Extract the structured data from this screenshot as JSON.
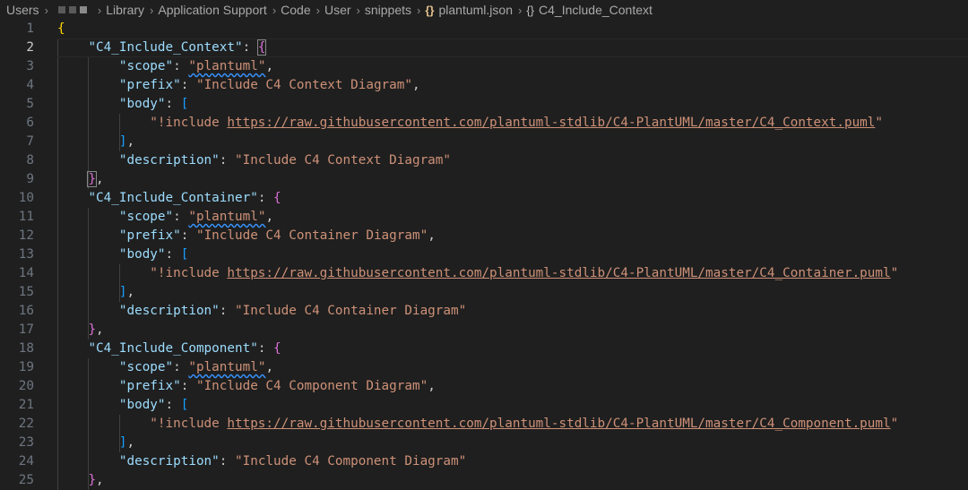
{
  "breadcrumb": {
    "items": [
      "Users",
      "Library",
      "Application Support",
      "Code",
      "User",
      "snippets",
      "plantuml.json",
      "C4_Include_Context"
    ],
    "file_icon": "{}",
    "symbol_icon": "{}"
  },
  "editor": {
    "active_line": 2,
    "lines": [
      {
        "n": "1",
        "tokens": [
          {
            "t": "{",
            "c": "b1"
          }
        ]
      },
      {
        "n": "2",
        "tokens": [
          {
            "t": "    "
          },
          {
            "t": "\"C4_Include_Context\"",
            "c": "k"
          },
          {
            "t": ": ",
            "c": "p"
          },
          {
            "t": "{",
            "c": "b2 bm"
          }
        ]
      },
      {
        "n": "3",
        "tokens": [
          {
            "t": "        "
          },
          {
            "t": "\"scope\"",
            "c": "k"
          },
          {
            "t": ": ",
            "c": "p"
          },
          {
            "t": "\"plantuml\"",
            "c": "s sq-und"
          },
          {
            "t": ",",
            "c": "p"
          }
        ]
      },
      {
        "n": "4",
        "tokens": [
          {
            "t": "        "
          },
          {
            "t": "\"prefix\"",
            "c": "k"
          },
          {
            "t": ": ",
            "c": "p"
          },
          {
            "t": "\"Include C4 Context Diagram\"",
            "c": "s"
          },
          {
            "t": ",",
            "c": "p"
          }
        ]
      },
      {
        "n": "5",
        "tokens": [
          {
            "t": "        "
          },
          {
            "t": "\"body\"",
            "c": "k"
          },
          {
            "t": ": ",
            "c": "p"
          },
          {
            "t": "[",
            "c": "b3"
          }
        ]
      },
      {
        "n": "6",
        "tokens": [
          {
            "t": "            "
          },
          {
            "t": "\"!include ",
            "c": "s"
          },
          {
            "t": "https://raw.githubusercontent.com/plantuml-stdlib/C4-PlantUML/master/C4_Context.puml",
            "c": "s u"
          },
          {
            "t": "\"",
            "c": "s"
          }
        ]
      },
      {
        "n": "7",
        "tokens": [
          {
            "t": "        "
          },
          {
            "t": "]",
            "c": "b3"
          },
          {
            "t": ",",
            "c": "p"
          }
        ]
      },
      {
        "n": "8",
        "tokens": [
          {
            "t": "        "
          },
          {
            "t": "\"description\"",
            "c": "k"
          },
          {
            "t": ": ",
            "c": "p"
          },
          {
            "t": "\"Include C4 Context Diagram\"",
            "c": "s"
          }
        ]
      },
      {
        "n": "9",
        "tokens": [
          {
            "t": "    "
          },
          {
            "t": "}",
            "c": "b2 bm"
          },
          {
            "t": ",",
            "c": "p"
          }
        ]
      },
      {
        "n": "10",
        "tokens": [
          {
            "t": "    "
          },
          {
            "t": "\"C4_Include_Container\"",
            "c": "k"
          },
          {
            "t": ": ",
            "c": "p"
          },
          {
            "t": "{",
            "c": "b2"
          }
        ]
      },
      {
        "n": "11",
        "tokens": [
          {
            "t": "        "
          },
          {
            "t": "\"scope\"",
            "c": "k"
          },
          {
            "t": ": ",
            "c": "p"
          },
          {
            "t": "\"plantuml\"",
            "c": "s sq-und"
          },
          {
            "t": ",",
            "c": "p"
          }
        ]
      },
      {
        "n": "12",
        "tokens": [
          {
            "t": "        "
          },
          {
            "t": "\"prefix\"",
            "c": "k"
          },
          {
            "t": ": ",
            "c": "p"
          },
          {
            "t": "\"Include C4 Container Diagram\"",
            "c": "s"
          },
          {
            "t": ",",
            "c": "p"
          }
        ]
      },
      {
        "n": "13",
        "tokens": [
          {
            "t": "        "
          },
          {
            "t": "\"body\"",
            "c": "k"
          },
          {
            "t": ": ",
            "c": "p"
          },
          {
            "t": "[",
            "c": "b3"
          }
        ]
      },
      {
        "n": "14",
        "tokens": [
          {
            "t": "            "
          },
          {
            "t": "\"!include ",
            "c": "s"
          },
          {
            "t": "https://raw.githubusercontent.com/plantuml-stdlib/C4-PlantUML/master/C4_Container.puml",
            "c": "s u"
          },
          {
            "t": "\"",
            "c": "s"
          }
        ]
      },
      {
        "n": "15",
        "tokens": [
          {
            "t": "        "
          },
          {
            "t": "]",
            "c": "b3"
          },
          {
            "t": ",",
            "c": "p"
          }
        ]
      },
      {
        "n": "16",
        "tokens": [
          {
            "t": "        "
          },
          {
            "t": "\"description\"",
            "c": "k"
          },
          {
            "t": ": ",
            "c": "p"
          },
          {
            "t": "\"Include C4 Container Diagram\"",
            "c": "s"
          }
        ]
      },
      {
        "n": "17",
        "tokens": [
          {
            "t": "    "
          },
          {
            "t": "}",
            "c": "b2"
          },
          {
            "t": ",",
            "c": "p"
          }
        ]
      },
      {
        "n": "18",
        "tokens": [
          {
            "t": "    "
          },
          {
            "t": "\"C4_Include_Component\"",
            "c": "k"
          },
          {
            "t": ": ",
            "c": "p"
          },
          {
            "t": "{",
            "c": "b2"
          }
        ]
      },
      {
        "n": "19",
        "tokens": [
          {
            "t": "        "
          },
          {
            "t": "\"scope\"",
            "c": "k"
          },
          {
            "t": ": ",
            "c": "p"
          },
          {
            "t": "\"plantuml\"",
            "c": "s sq-und"
          },
          {
            "t": ",",
            "c": "p"
          }
        ]
      },
      {
        "n": "20",
        "tokens": [
          {
            "t": "        "
          },
          {
            "t": "\"prefix\"",
            "c": "k"
          },
          {
            "t": ": ",
            "c": "p"
          },
          {
            "t": "\"Include C4 Component Diagram\"",
            "c": "s"
          },
          {
            "t": ",",
            "c": "p"
          }
        ]
      },
      {
        "n": "21",
        "tokens": [
          {
            "t": "        "
          },
          {
            "t": "\"body\"",
            "c": "k"
          },
          {
            "t": ": ",
            "c": "p"
          },
          {
            "t": "[",
            "c": "b3"
          }
        ]
      },
      {
        "n": "22",
        "tokens": [
          {
            "t": "            "
          },
          {
            "t": "\"!include ",
            "c": "s"
          },
          {
            "t": "https://raw.githubusercontent.com/plantuml-stdlib/C4-PlantUML/master/C4_Component.puml",
            "c": "s u"
          },
          {
            "t": "\"",
            "c": "s"
          }
        ]
      },
      {
        "n": "23",
        "tokens": [
          {
            "t": "        "
          },
          {
            "t": "]",
            "c": "b3"
          },
          {
            "t": ",",
            "c": "p"
          }
        ]
      },
      {
        "n": "24",
        "tokens": [
          {
            "t": "        "
          },
          {
            "t": "\"description\"",
            "c": "k"
          },
          {
            "t": ": ",
            "c": "p"
          },
          {
            "t": "\"Include C4 Component Diagram\"",
            "c": "s"
          }
        ]
      },
      {
        "n": "25",
        "tokens": [
          {
            "t": "    "
          },
          {
            "t": "}",
            "c": "b2"
          },
          {
            "t": ",",
            "c": "p"
          }
        ]
      }
    ]
  }
}
